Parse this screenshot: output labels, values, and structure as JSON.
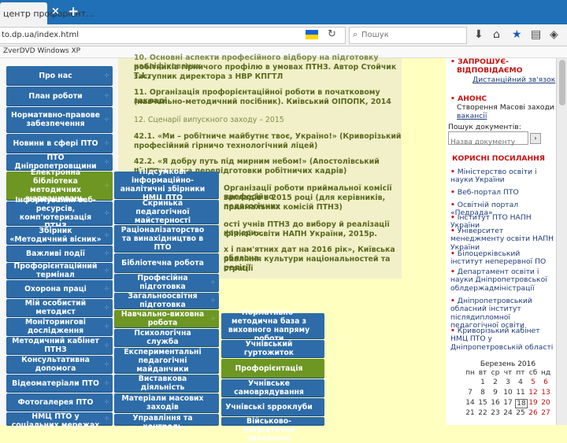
{
  "browser": {
    "tab_title": "центр профорієнт...",
    "tab_close": "×",
    "new_tab": "+",
    "url": "to.dp.ua/index.html",
    "search_placeholder": "Пошук",
    "reload": "↻",
    "bookmark_label": "ZverDVD Windows XP"
  },
  "left_menu": [
    {
      "label": "Про нас"
    },
    {
      "label": "План роботи"
    },
    {
      "label": "Нормативно-правове забезпечення"
    },
    {
      "label": "Новини в сфері ПТО"
    },
    {
      "label": "ПТО Дніпропетровщини"
    },
    {
      "label": "Електронна бібліотека методичних напрацювань"
    },
    {
      "label": "Інформування веб-ресурсів, комп'ютеризація ПТНЗ"
    },
    {
      "label": "Збірник «Методичний вісник»"
    },
    {
      "label": "Важливі події"
    },
    {
      "label": "Профорієнтаційний термінал"
    },
    {
      "label": "Охорона праці"
    },
    {
      "label": "Мій особистий методист"
    },
    {
      "label": "Моніторингові дослідження"
    },
    {
      "label": "Методичний кабінет ПТНЗ"
    },
    {
      "label": "Консультативна допомога"
    },
    {
      "label": "Відеоматеріали ПТО"
    },
    {
      "label": "Фотогалерея ПТО"
    },
    {
      "label": "НМЦ ПТО у соціальних мережах"
    }
  ],
  "submenu_1": [
    {
      "label": "Підсумкові інформаційно-аналітичні збірники НМЦ ПТО"
    },
    {
      "label": "Скринька педагогічної майстерності"
    },
    {
      "label": "Раціоналізаторство та винахідництво в ПТО"
    },
    {
      "label": "Бібліотечна робота"
    },
    {
      "label": "Професійна підготовка"
    },
    {
      "label": "Загальноосвітня підготовка"
    },
    {
      "label": "Навчально-виховна робота"
    },
    {
      "label": "Психологічна служба"
    },
    {
      "label": "Експериментальні педагогічні майданчики"
    },
    {
      "label": "Виставкова діяльність"
    },
    {
      "label": "Матеріали масових заходів"
    },
    {
      "label": "Управління та контроль"
    }
  ],
  "submenu_2": [
    {
      "label": "Нормативно-методична база з виховного напряму роботи"
    },
    {
      "label": "Учнівський гуртожиток"
    },
    {
      "label": "Профорієнтація"
    },
    {
      "label": "Учнівське самоврядування"
    },
    {
      "label": "Учнівські spроклуби"
    },
    {
      "label": "Військово-патріотичне виховання"
    }
  ],
  "content": {
    "line_1": "10. Основні аспекти професійного відбору на підготовку кваліфікованих",
    "line_2": "робітників гірничого профілю в умовах ПТНЗ. Автор Стойчик Т.І.,",
    "line_3": "заступник директора з НВР КПГТЛ",
    "line_4": "11. Організація профорієнтаційної роботи в початковому закладі",
    "line_5": "(навчально-методичний посібник). Київський ОІПОПК, 2014",
    "line_6": "12. Сценарії випускного заходу – 2015",
    "line_7": "42.1. «Ми – робітниче майбутнє твоє, Україно!» (Криворізький",
    "line_8": "професійний гірничо технологічний ліцей)",
    "line_9": "42.2. «Я добру путь під мирним небом!» (Апостолівський центр",
    "line_10": "підготовки та перепідготовки робітничих кадрів)",
    "line_11": "Організації роботи приймальної комісії професійно",
    "line_12": "закладів в 2015 році (для керівників, педагогічних",
    "line_13": "приймальних комісій ПТНЗ)",
    "line_14": "ості учнів ПТНЗ до вибору й реалізації кар'єри».",
    "line_15": "фічної освіти НАПН України, 2015р.",
    "line_16": "х і пам'ятних дат на 2016 рік», Київська обласна",
    "line_17": "равління культури національностей та релігії",
    "line_18": "страції"
  },
  "right": {
    "announce_1_title": "ЗАПРОШУЄ-",
    "announce_1_title2": "ВІДПОВІДАЄМО",
    "announce_1_sub": "Дистанційний зв'язок",
    "announce_2_title": "АНОНС",
    "announce_2_sub": "Створення Масові заходи",
    "announce_2_link": "вакансії",
    "search_label": "Пошук документів:",
    "search_placeholder": "Назва документу",
    "links_title": "КОРИСНІ ПОСИЛАННЯ",
    "links": [
      "Міністерство освіти і науки України",
      "Веб-портал ПТО",
      "Освітній портал «Педрада»",
      "Інститут ПТО НАПН України",
      "Університет менеджменту освіти НАПН України",
      "Білоцерківський інститут неперервної ПО",
      "Департамент освіти і науки Дніпропетровської облдержадміністрації",
      "Дніпропетровський обласний інститут післядипломної педагогічної освіти",
      "Криворізький кабінет НМЦ ПТО у Дніпропетровській області"
    ],
    "calendar_title": "Березень 2016",
    "calendar_head": [
      "пн",
      "вт",
      "ср",
      "чт",
      "пт",
      "сб",
      "нд"
    ],
    "calendar_rows": [
      [
        "",
        "1",
        "2",
        "3",
        "4",
        "5",
        "6"
      ],
      [
        "7",
        "8",
        "9",
        "10",
        "11",
        "12",
        "13"
      ],
      [
        "14",
        "15",
        "16",
        "17",
        "18",
        "19",
        "20"
      ],
      [
        "21",
        "22",
        "23",
        "24",
        "25",
        "26",
        "27"
      ]
    ],
    "today": "18"
  }
}
